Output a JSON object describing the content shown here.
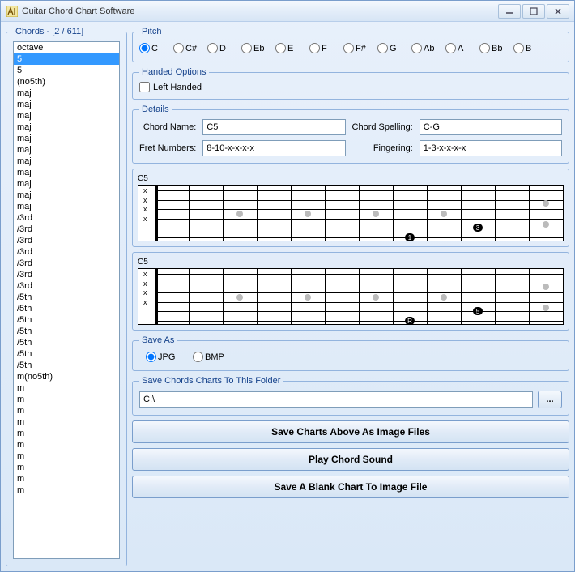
{
  "window": {
    "title": "Guitar Chord Chart Software"
  },
  "chords": {
    "legend": "Chords - [2 / 611]",
    "selected_index": 1,
    "items": [
      "octave",
      "5",
      "5",
      "(no5th)",
      "maj",
      "maj",
      "maj",
      "maj",
      "maj",
      "maj",
      "maj",
      "maj",
      "maj",
      "maj",
      "maj",
      "/3rd",
      "/3rd",
      "/3rd",
      "/3rd",
      "/3rd",
      "/3rd",
      "/3rd",
      "/5th",
      "/5th",
      "/5th",
      "/5th",
      "/5th",
      "/5th",
      "/5th",
      "m(no5th)",
      "m",
      "m",
      "m",
      "m",
      "m",
      "m",
      "m",
      "m",
      "m",
      "m"
    ]
  },
  "pitch": {
    "legend": "Pitch",
    "selected": "C",
    "options": [
      "C",
      "C#",
      "D",
      "Eb",
      "E",
      "F",
      "F#",
      "G",
      "Ab",
      "A",
      "Bb",
      "B"
    ]
  },
  "handed": {
    "legend": "Handed Options",
    "left_label": "Left Handed",
    "left_checked": false
  },
  "details": {
    "legend": "Details",
    "chord_name_label": "Chord Name:",
    "chord_name": "C5",
    "chord_spelling_label": "Chord Spelling:",
    "chord_spelling": "C-G",
    "fret_numbers_label": "Fret Numbers:",
    "fret_numbers": "8-10-x-x-x-x",
    "fingering_label": "Fingering:",
    "fingering": "1-3-x-x-x-x"
  },
  "diagram1": {
    "title": "C5",
    "finger_labels": [
      "1",
      "3"
    ]
  },
  "diagram2": {
    "title": "C5",
    "finger_labels": [
      "R",
      "5"
    ]
  },
  "saveas": {
    "legend": "Save As",
    "selected": "JPG",
    "options": [
      "JPG",
      "BMP"
    ]
  },
  "folder": {
    "legend": "Save Chords Charts To This Folder",
    "path": "C:\\",
    "browse_label": "..."
  },
  "buttons": {
    "save_charts": "Save Charts Above As Image Files",
    "play_sound": "Play Chord Sound",
    "save_blank": "Save A Blank Chart To Image File"
  }
}
